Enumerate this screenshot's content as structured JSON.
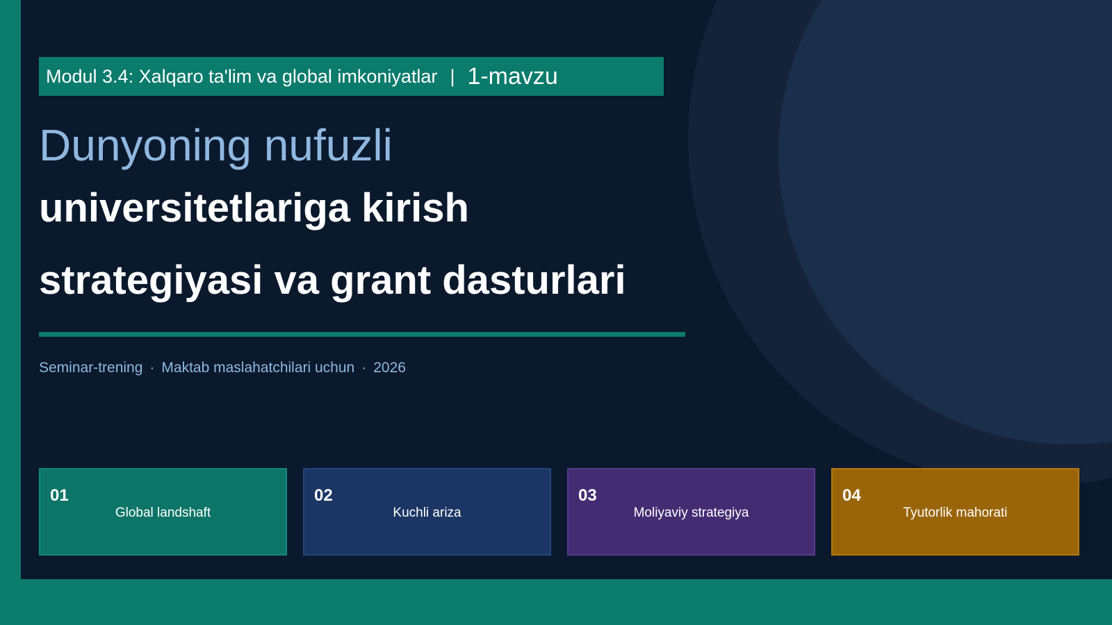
{
  "module": {
    "title": "Modul 3.4: Xalqaro ta'lim va global imkoniyatlar",
    "separator": "|",
    "topic": "1-mavzu"
  },
  "title": {
    "line1": "Dunyoning nufuzli",
    "line2": "universitetlariga kirish",
    "line3": "strategiyasi va grant dasturlari"
  },
  "subtitle": {
    "part1": "Seminar-trening",
    "part2": "Maktab maslahatchilari uchun",
    "part3": "2026",
    "dot": "·"
  },
  "cards": [
    {
      "num": "01",
      "label": "Global landshaft",
      "color": "#0c7567",
      "border": "#0f8a78"
    },
    {
      "num": "02",
      "label": "Kuchli ariza",
      "color": "#1b3664",
      "border": "#26467a"
    },
    {
      "num": "03",
      "label": "Moliyaviy strategiya",
      "color": "#442c73",
      "border": "#573a8c"
    },
    {
      "num": "04",
      "label": "Tyutorlik mahorati",
      "color": "#9a6508",
      "border": "#b57a10"
    }
  ],
  "colors": {
    "accent": "#0b7b6c",
    "background": "#0b192d",
    "title_light": "#8fb8e0"
  }
}
